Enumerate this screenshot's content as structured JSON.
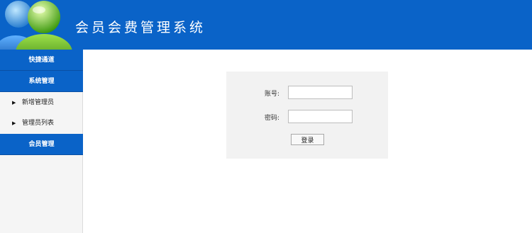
{
  "header": {
    "title": "会员会费管理系统",
    "logo_icon": "users-avatar-icon",
    "background_color": "#0a63c8"
  },
  "sidebar": {
    "quick_access": "快捷通道",
    "system_management": "系统管理",
    "items": [
      {
        "label": "新增管理员",
        "icon": "triangle-right-icon"
      },
      {
        "label": "管理员列表",
        "icon": "triangle-right-icon"
      }
    ],
    "member_management": "会员管理"
  },
  "login_form": {
    "account_label": "账号:",
    "account_value": "",
    "password_label": "密码:",
    "password_value": "",
    "submit_label": "登录"
  }
}
